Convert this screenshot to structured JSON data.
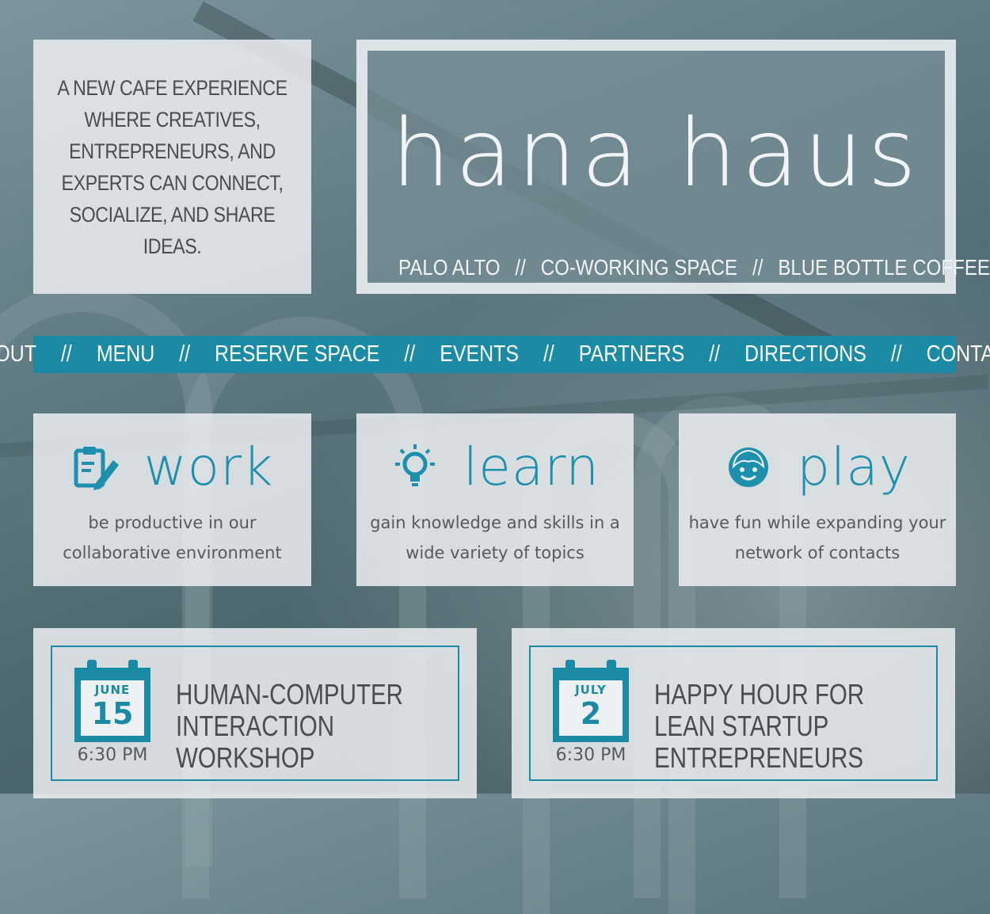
{
  "tagline": "A new cafe experience where creatives, entrepreneurs, and experts can connect, socialize, and share ideas.",
  "hero": {
    "brand": "hana haus",
    "sub_items": [
      "PALO ALTO",
      "CO-WORKING SPACE",
      "BLUE BOTTLE COFFEE"
    ],
    "separator": "//"
  },
  "nav": {
    "items": [
      "ABOUT",
      "MENU",
      "RESERVE SPACE",
      "EVENTS",
      "PARTNERS",
      "DIRECTIONS",
      "CONTACT"
    ],
    "separator": "//"
  },
  "features": [
    {
      "word": "work",
      "icon": "clipboard-pencil-icon",
      "desc": "be productive in our collaborative environment"
    },
    {
      "word": "learn",
      "icon": "lightbulb-icon",
      "desc": "gain knowledge and skills in a wide variety of topics"
    },
    {
      "word": "play",
      "icon": "smiley-face-icon",
      "desc": "have fun while expanding your network of contacts"
    }
  ],
  "events": [
    {
      "month": "JUNE",
      "day": "15",
      "time": "6:30 PM",
      "title": "HUMAN-COMPUTER INTERACTION WORKSHOP"
    },
    {
      "month": "JULY",
      "day": "2",
      "time": "6:30 PM",
      "title": "HAPPY HOUR FOR LEAN STARTUP ENTREPRENEURS"
    }
  ],
  "colors": {
    "accent": "#1a8aa5",
    "panel": "#ebeef0",
    "text_dark": "#4a4d50"
  }
}
